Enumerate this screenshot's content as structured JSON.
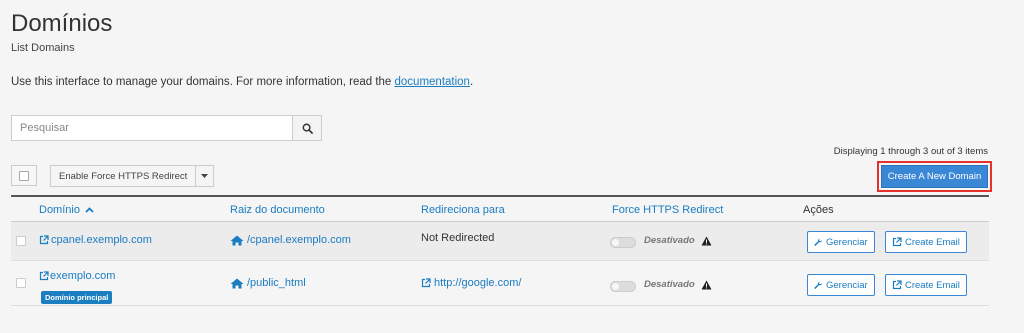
{
  "page": {
    "title": "Domínios",
    "subtitle": "List Domains",
    "intro_text": "Use this interface to manage your domains. For more information, read the ",
    "intro_link": "documentation",
    "intro_end": "."
  },
  "search": {
    "placeholder": "Pesquisar"
  },
  "toolbar": {
    "https_label": "Enable Force HTTPS Redirect",
    "create_label": "Create A New Domain",
    "displaying": "Displaying 1 through 3 out of 3 items"
  },
  "table": {
    "headers": {
      "domain": "Domínio",
      "docroot": "Raiz do documento",
      "redirect": "Redireciona para",
      "force_https": "Force HTTPS Redirect",
      "actions": "Ações"
    },
    "rows": [
      {
        "domain": "cpanel.exemplo.com",
        "docroot": "/cpanel.exemplo.com",
        "redirect": "Not Redirected",
        "https_status": "Desativado",
        "manage_label": "Gerenciar",
        "email_label": "Create Email"
      },
      {
        "domain": "exemplo.com",
        "badge": "Domínio principal",
        "docroot": "/public_html",
        "redirect": "http://google.com/",
        "https_status": "Desativado",
        "manage_label": "Gerenciar",
        "email_label": "Create Email"
      }
    ]
  },
  "colors": {
    "accent": "#1a7cc1",
    "primary_button": "#3a87d5",
    "highlight": "#e53129",
    "badge": "#1b7ec1"
  }
}
